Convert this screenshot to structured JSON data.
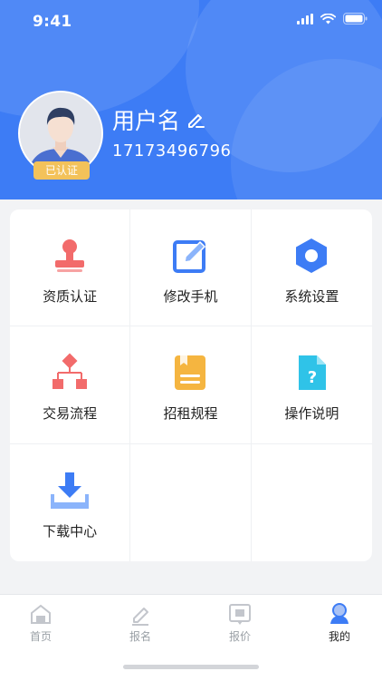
{
  "status_bar": {
    "time": "9:41"
  },
  "profile": {
    "username": "用户名",
    "phone": "17173496796",
    "badge": "已认证"
  },
  "grid": [
    {
      "label": "资质认证",
      "icon": "stamp-icon",
      "color": "#f26b6b"
    },
    {
      "label": "修改手机",
      "icon": "edit-icon",
      "color": "#3d7cf5"
    },
    {
      "label": "系统设置",
      "icon": "settings-icon",
      "color": "#3d7cf5"
    },
    {
      "label": "交易流程",
      "icon": "flowchart-icon",
      "color": "#f26b6b"
    },
    {
      "label": "招租规程",
      "icon": "document-icon",
      "color": "#f5b540"
    },
    {
      "label": "操作说明",
      "icon": "help-file-icon",
      "color": "#2fc3e8"
    },
    {
      "label": "下载中心",
      "icon": "download-icon",
      "color": "#3d7cf5"
    }
  ],
  "tabs": [
    {
      "label": "首页",
      "icon": "home-icon",
      "active": false
    },
    {
      "label": "报名",
      "icon": "signup-icon",
      "active": false
    },
    {
      "label": "报价",
      "icon": "quote-icon",
      "active": false
    },
    {
      "label": "我的",
      "icon": "profile-icon",
      "active": true
    }
  ],
  "colors": {
    "primary": "#3d7cf5",
    "badge": "#f3c25a",
    "background": "#f2f3f5"
  }
}
